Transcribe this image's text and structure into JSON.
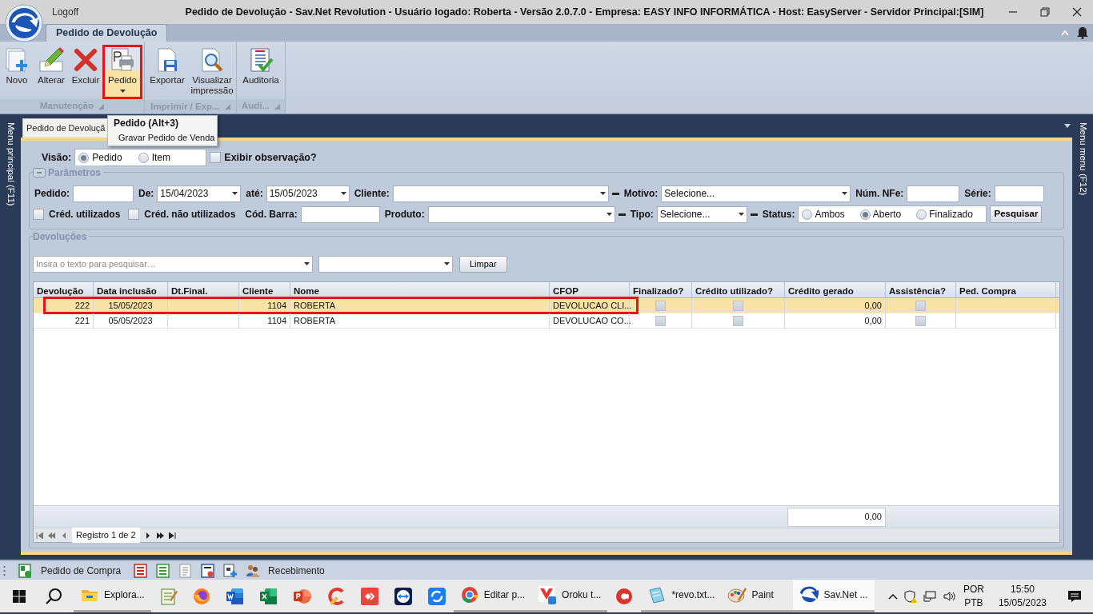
{
  "window": {
    "logoff": "Logoff",
    "title": "Pedido de Devolução - Sav.Net Revolution - Usuário logado: Roberta - Versão 2.0.7.0 - Empresa: EASY INFO INFORMÁTICA - Host: EasyServer - Servidor Principal:[SIM]"
  },
  "ribbon": {
    "tabs": [
      {
        "label": "Pedido de Devolução",
        "selected": true
      }
    ],
    "groups": [
      {
        "label": "Manutenção",
        "buttons": [
          {
            "kind": "new",
            "label": "Novo",
            "highlighted": false
          },
          {
            "kind": "edit",
            "label": "Alterar",
            "highlighted": false
          },
          {
            "kind": "delete",
            "label": "Excluir",
            "highlighted": false
          },
          {
            "kind": "print-order",
            "label": "Pedido",
            "highlighted": true,
            "dropdown": true
          }
        ]
      },
      {
        "label": "Imprimir / Exp...",
        "buttons": [
          {
            "kind": "export",
            "label": "Exportar",
            "highlighted": false
          },
          {
            "kind": "preview",
            "label": "Visualizar impressão",
            "highlighted": false
          }
        ]
      },
      {
        "label": "Audi...",
        "buttons": [
          {
            "kind": "audit",
            "label": "Auditoria",
            "highlighted": false
          }
        ]
      }
    ]
  },
  "tooltip": {
    "title": "Pedido (Alt+3)",
    "text": "Gravar Pedido de Venda"
  },
  "side_panels": {
    "left": "Menu principal (F11)",
    "right": "Menu menu (F12)"
  },
  "document_tabs": [
    {
      "label": "Pedido de Devoluçã",
      "selected": true
    }
  ],
  "view": {
    "label": "Visão:",
    "options": [
      {
        "label": "Pedido",
        "selected": true
      },
      {
        "label": "Item",
        "selected": false
      }
    ],
    "show_notes": {
      "label": "Exibir observação?",
      "checked": false
    }
  },
  "parameters": {
    "title": "Parâmetros",
    "expanded": true,
    "rows": [
      [
        {
          "kind": "text",
          "label": "Pedido:"
        },
        {
          "kind": "date",
          "label": "De:",
          "value": "15/04/2023"
        },
        {
          "kind": "date",
          "label": "até:",
          "value": "15/05/2023"
        },
        {
          "kind": "combo",
          "label": "Cliente:",
          "clearable": true
        },
        {
          "kind": "combo",
          "label": "Motivo:",
          "value": "Selecione...",
          "clearable": false
        },
        {
          "kind": "text",
          "label": "Núm. NFe:"
        },
        {
          "kind": "text",
          "label": "Série:"
        }
      ],
      [
        {
          "kind": "check",
          "label": "Créd. utilizados",
          "checked": false
        },
        {
          "kind": "check",
          "label": "Créd. não utilizados",
          "checked": false
        },
        {
          "kind": "text",
          "label": "Cód. Barra:"
        },
        {
          "kind": "combo",
          "label": "Produto:",
          "clearable": true
        },
        {
          "kind": "combo",
          "label": "Tipo:",
          "value": "Selecione...",
          "clearable": true
        },
        {
          "kind": "radio",
          "label": "Status:",
          "options": [
            {
              "label": "Ambos",
              "selected": false
            },
            {
              "label": "Aberto",
              "selected": true
            },
            {
              "label": "Finalizado",
              "selected": false
            }
          ]
        },
        {
          "kind": "button",
          "label": "Pesquisar"
        }
      ]
    ]
  },
  "returns": {
    "title": "Devoluções",
    "search": {
      "placeholder": "Insira o texto para pesquisar…"
    },
    "clear_button": "Limpar",
    "columns": [
      {
        "label": "Devolução",
        "kind": "number"
      },
      {
        "label": "Data inclusão",
        "kind": "date"
      },
      {
        "label": "Dt.Final.",
        "kind": "date"
      },
      {
        "label": "Cliente",
        "kind": "number"
      },
      {
        "label": "Nome",
        "kind": "text"
      },
      {
        "label": "CFOP",
        "kind": "text"
      },
      {
        "label": "Finalizado?",
        "kind": "check"
      },
      {
        "label": "Crédito utilizado?",
        "kind": "check"
      },
      {
        "label": "Crédito gerado",
        "kind": "number"
      },
      {
        "label": "Assistência?",
        "kind": "check"
      },
      {
        "label": "Ped. Compra",
        "kind": "text"
      }
    ],
    "rows": [
      {
        "selected": true,
        "marked": true,
        "cells": [
          "222",
          "15/05/2023",
          null,
          "1104",
          "ROBERTA",
          "DEVOLUCAO CLI...",
          false,
          false,
          "0,00",
          false,
          null
        ]
      },
      {
        "selected": false,
        "marked": false,
        "cells": [
          "221",
          "05/05/2023",
          null,
          "1104",
          "ROBERTA",
          "DEVOLUCAO CO...",
          false,
          false,
          "0,00",
          false,
          null
        ]
      }
    ],
    "total": "0,00",
    "navigator": "Registro 1 de 2"
  },
  "quickbar": [
    {
      "kind": "purchase",
      "label": "Pedido de Compra"
    },
    {
      "kind": "red-list"
    },
    {
      "kind": "green-list"
    },
    {
      "kind": "sheet"
    },
    {
      "kind": "nfe"
    },
    {
      "kind": "add-doc"
    },
    {
      "kind": "people",
      "label": "Recebimento"
    }
  ],
  "taskbar": {
    "apps": [
      {
        "kind": "explorer",
        "label": "Explora...",
        "running": true,
        "active": false
      },
      {
        "kind": "notepad2",
        "running": false,
        "active": false
      },
      {
        "kind": "firefox",
        "running": false,
        "active": false
      },
      {
        "kind": "word",
        "running": false,
        "active": false
      },
      {
        "kind": "excel",
        "running": false,
        "active": false
      },
      {
        "kind": "powerpoint",
        "running": false,
        "active": false
      },
      {
        "kind": "ccleaner",
        "running": false,
        "active": false
      },
      {
        "kind": "anydesk",
        "running": false,
        "active": false
      },
      {
        "kind": "teamviewer",
        "running": false,
        "active": false
      },
      {
        "kind": "ring",
        "running": false,
        "active": false
      },
      {
        "kind": "chrome",
        "label": "Editar p...",
        "running": true,
        "active": false
      },
      {
        "kind": "vivaldi",
        "label": "Oroku t...",
        "running": true,
        "active": false
      },
      {
        "kind": "cleaner",
        "running": false,
        "active": false
      },
      {
        "kind": "notepad",
        "label": "*revo.txt...",
        "running": true,
        "active": false
      },
      {
        "kind": "paint",
        "label": "Paint",
        "running": true,
        "active": false
      },
      {
        "kind": "savnet",
        "label": "Sav.Net ...",
        "running": true,
        "active": true
      }
    ],
    "tray": {
      "language": "POR",
      "layout": "PTB",
      "time": "15:50",
      "date": "15/05/2023"
    }
  }
}
